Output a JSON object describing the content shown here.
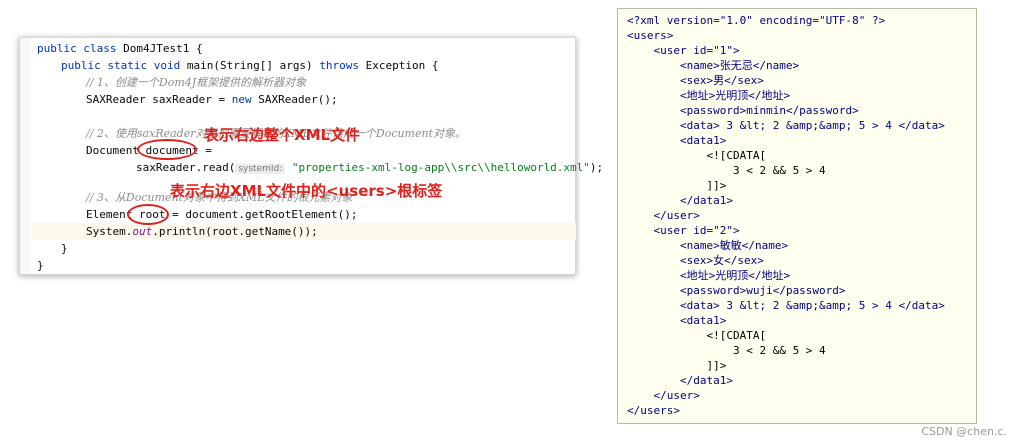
{
  "editor": {
    "lines": {
      "l1": {
        "kw": "public class ",
        "rest": "Dom4JTest1 {"
      },
      "l2": {
        "kw1": "public static void ",
        "m": "main",
        "a": "(String[] args) ",
        "kw2": "throws ",
        "b": "Exception {"
      },
      "l3": {
        "comment": "// 1、创建一个Dom4J框架提供的解析器对象"
      },
      "l4": {
        "a": "SAXReader saxReader = ",
        "kw": "new ",
        "b": "SAXReader();"
      },
      "l5": {
        "comment": "// 2、使用saxReader对象把需要解析的XML文件读成一个Document对象。"
      },
      "l6": {
        "a": "Document ",
        "v": "document",
        "b": " ="
      },
      "l7": {
        "a": "saxReader.read(",
        "hint": "systemId:",
        "str": "\"properties-xml-log-app\\\\src\\\\helloworld.xml\"",
        "b": ");"
      },
      "l8": {
        "comment": "// 3、从Document对象中得到XML文件的根元素对象"
      },
      "l9": {
        "a": "Element ",
        "v": "root",
        "b": " = document.getRootElement();"
      },
      "l10": {
        "a": "System.",
        "it": "out",
        "b": ".println(root.getName());"
      },
      "l11": {
        "rest": "}"
      },
      "l12": {
        "rest": "}"
      }
    }
  },
  "annotations": {
    "a1": "表示右边整个XML文件",
    "a2": "表示右边XML文件中的<users>根标签"
  },
  "xml": {
    "lines": [
      "<?xml version=\"1.0\" encoding=\"UTF-8\" ?>",
      "<users>",
      "    <user id=\"1\">",
      "        <name>张无忌</name>",
      "        <sex>男</sex>",
      "        <地址>光明顶</地址>",
      "        <password>minmin</password>",
      "        <data> 3 &lt; 2 &amp;&amp; 5 > 4 </data>",
      "        <data1>",
      "            <![CDATA[",
      "                3 < 2 && 5 > 4",
      "            ]]>",
      "        </data1>",
      "    </user>",
      "    <user id=\"2\">",
      "        <name>敏敏</name>",
      "        <sex>女</sex>",
      "        <地址>光明顶</地址>",
      "        <password>wuji</password>",
      "        <data> 3 &lt; 2 &amp;&amp; 5 > 4 </data>",
      "        <data1>",
      "            <![CDATA[",
      "                3 < 2 && 5 > 4",
      "            ]]>",
      "        </data1>",
      "    </user>",
      "</users>"
    ]
  },
  "watermark": "CSDN @chen.c."
}
